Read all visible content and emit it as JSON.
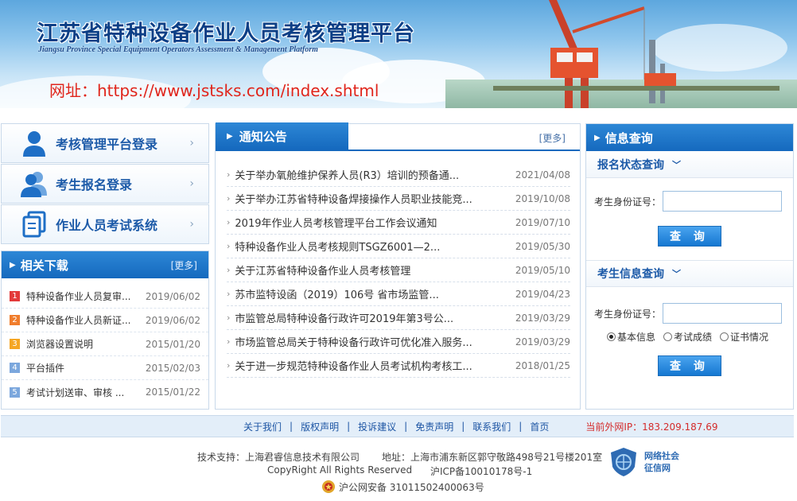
{
  "banner": {
    "title": "江苏省特种设备作业人员考核管理平台",
    "subtitle": "Jiangsu Province Special Equipment Operators Assessment & Management Platform",
    "url_text": "网址：https://www.jstsks.com/index.shtml"
  },
  "login": {
    "items": [
      {
        "label": "考核管理平台登录",
        "icon": "person-icon"
      },
      {
        "label": "考生报名登录",
        "icon": "people-icon"
      },
      {
        "label": "作业人员考试系统",
        "icon": "documents-icon"
      }
    ]
  },
  "downloads": {
    "title": "相关下载",
    "more": "[更多]",
    "items": [
      {
        "num": "1",
        "title": "特种设备作业人员复审...",
        "date": "2019/06/02",
        "color": "#e33a3a"
      },
      {
        "num": "2",
        "title": "特种设备作业人员新证...",
        "date": "2019/06/02",
        "color": "#f07d2c"
      },
      {
        "num": "3",
        "title": "浏览器设置说明",
        "date": "2015/01/20",
        "color": "#f5a623"
      },
      {
        "num": "4",
        "title": "平台插件",
        "date": "2015/02/03",
        "color": "#7ba7dd"
      },
      {
        "num": "5",
        "title": "考试计划送审、审核 ...",
        "date": "2015/01/22",
        "color": "#7ba7dd"
      }
    ]
  },
  "notices": {
    "title": "通知公告",
    "more": "[更多]",
    "items": [
      {
        "title": "关于举办氧舱维护保养人员(R3）培训的预备通...",
        "date": "2021/04/08"
      },
      {
        "title": "关于举办江苏省特种设备焊接操作人员职业技能竞...",
        "date": "2019/10/08"
      },
      {
        "title": "2019年作业人员考核管理平台工作会议通知",
        "date": "2019/07/10"
      },
      {
        "title": "特种设备作业人员考核规则TSGZ6001—2...",
        "date": "2019/05/30"
      },
      {
        "title": "关于江苏省特种设备作业人员考核管理",
        "date": "2019/05/10"
      },
      {
        "title": "苏市监特设函（2019）106号 省市场监管...",
        "date": "2019/04/23"
      },
      {
        "title": "市监管总局特种设备行政许可2019年第3号公...",
        "date": "2019/03/29"
      },
      {
        "title": "市场监管总局关于特种设备行政许可优化准入服务...",
        "date": "2019/03/29"
      },
      {
        "title": "关于进一步规范特种设备作业人员考试机构考核工...",
        "date": "2018/01/25"
      }
    ]
  },
  "query": {
    "title": "信息查询",
    "section1": {
      "title": "报名状态查询",
      "label": "考生身份证号：",
      "value": "",
      "button": "查 询"
    },
    "section2": {
      "title": "考生信息查询",
      "label": "考生身份证号：",
      "value": "",
      "button": "查 询",
      "options": [
        {
          "label": "基本信息",
          "checked": true
        },
        {
          "label": "考试成绩",
          "checked": false
        },
        {
          "label": "证书情况",
          "checked": false
        }
      ]
    }
  },
  "footer": {
    "links": [
      "关于我们",
      "版权声明",
      "投诉建议",
      "免责声明",
      "联系我们",
      "首页"
    ],
    "ip": "当前外网IP：183.209.187.69",
    "tech_support": "技术支持：上海君睿信息技术有限公司",
    "address": "地址：上海市浦东新区郭守敬路498号21号楼201室",
    "copyright": "CopyRight All Rights Reserved",
    "icp": "沪ICP备10010178号-1",
    "police": "沪公网安备 31011502400063号",
    "badge_text_1": "网络社会",
    "badge_text_2": "征信网"
  },
  "colors": {
    "primary": "#1569be",
    "accent_red": "#e0251b"
  }
}
